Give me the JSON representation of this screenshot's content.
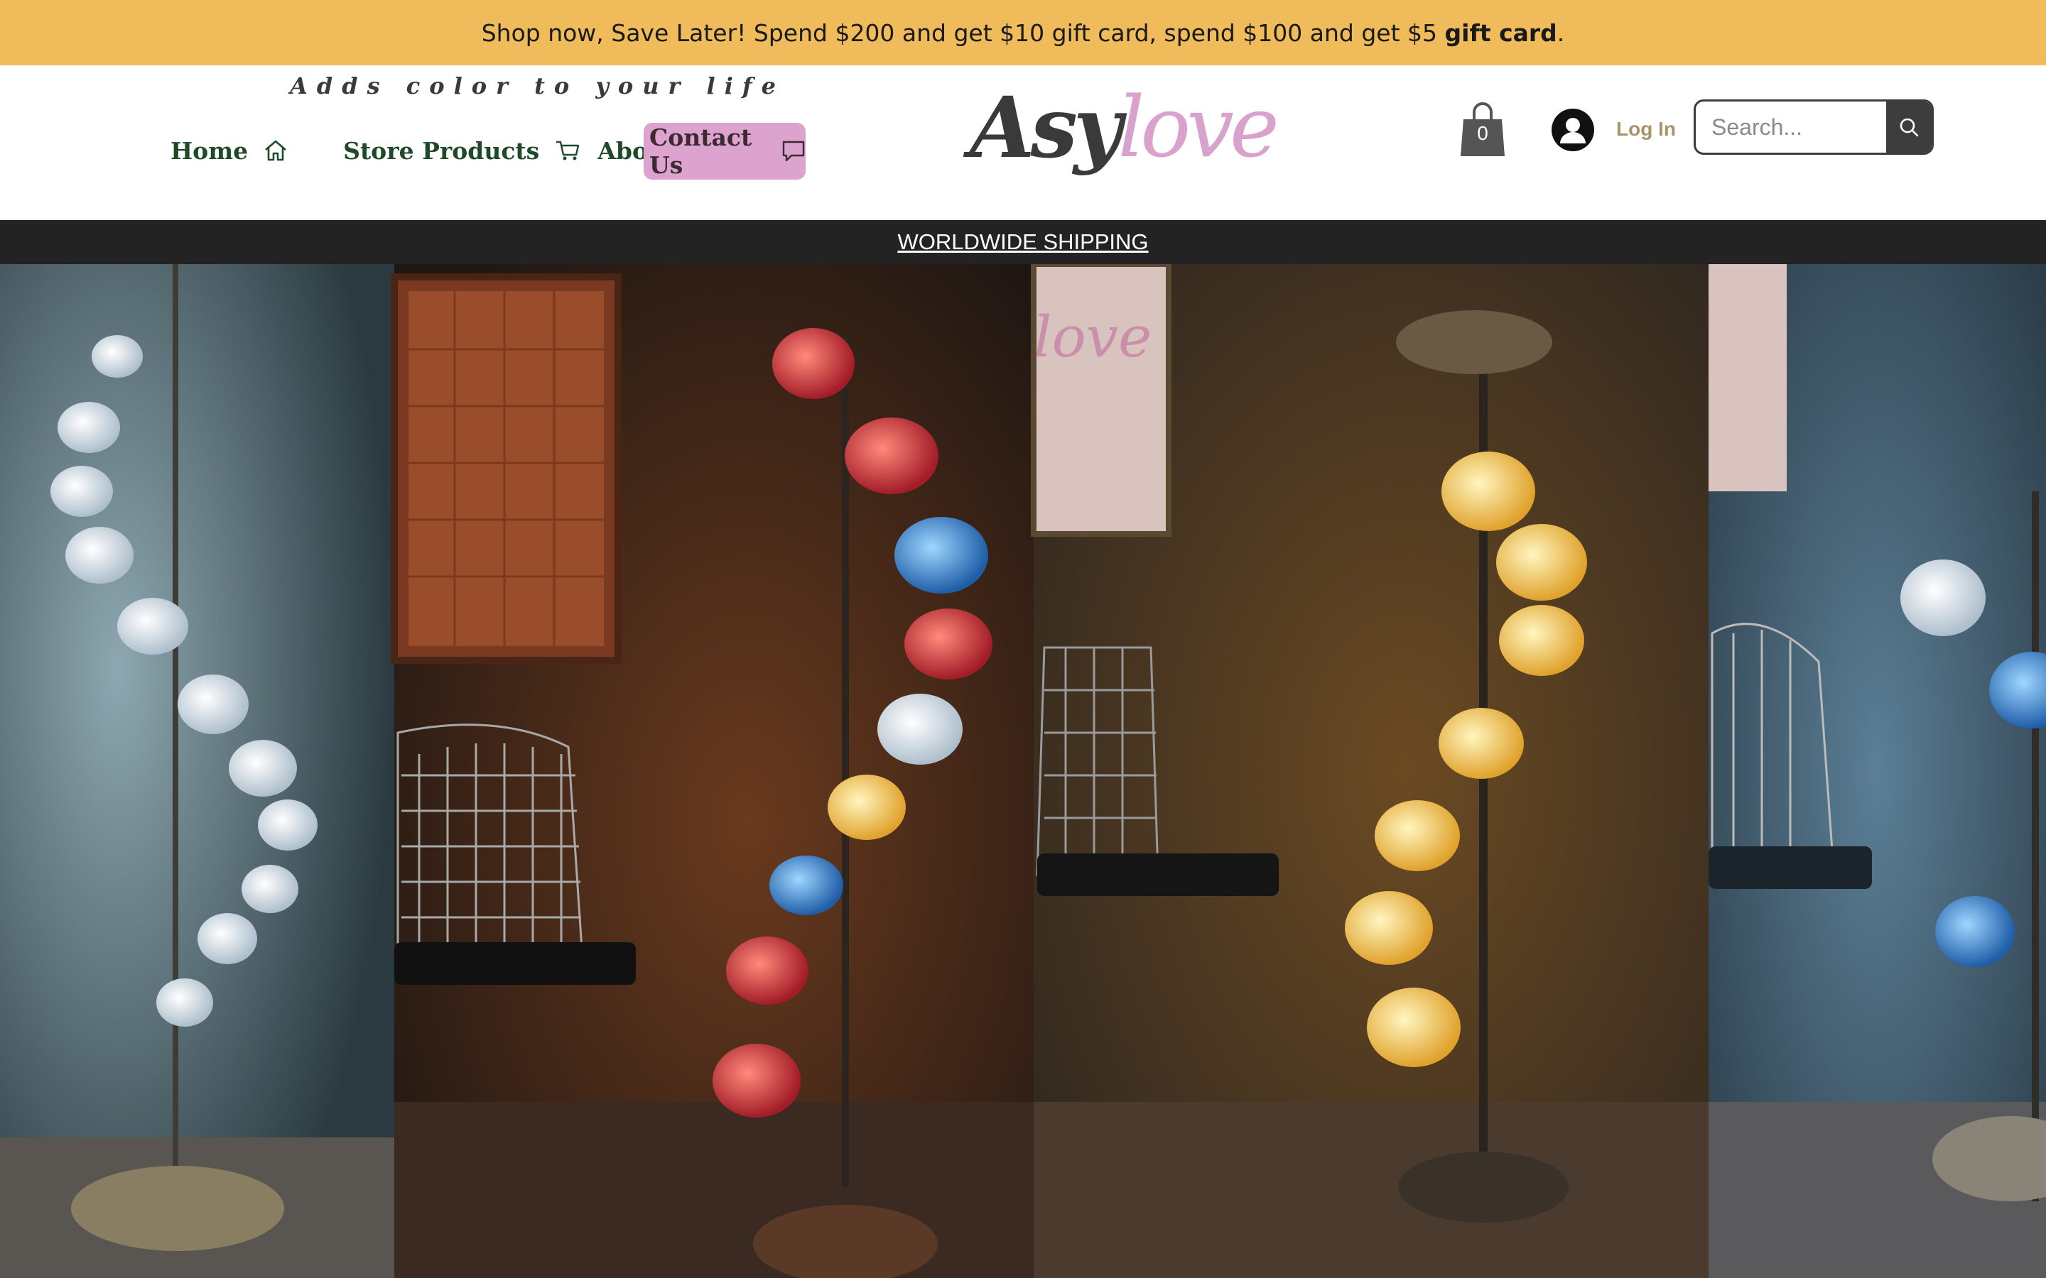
{
  "promo": {
    "text_lead": "Shop now, Save Later! Spend $200 and get $10 gift card, spend $100 and get $5 ",
    "text_bold": "gift card",
    "text_tail": "."
  },
  "header": {
    "tagline": "Adds color to your life",
    "nav": {
      "home": "Home",
      "store": "Store Products",
      "about": "About",
      "contact": "Contact Us"
    },
    "logo": {
      "part1": "Asy",
      "part2": "love"
    },
    "cart_count": "0",
    "login": "Log In",
    "search_placeholder": "Search..."
  },
  "shipping": {
    "label": "WORLDWIDE SHIPPING"
  },
  "colors": {
    "promo_bg": "#efbb5b",
    "nav_text": "#1f4a2a",
    "contact_bg": "#dca3cf",
    "logo_pink": "#d9a2cc",
    "login_text": "#a6946a",
    "shipping_bg": "#232323"
  },
  "icons": {
    "home": "home-icon",
    "cart_nav": "cart-icon",
    "contact": "chat-bubble-icon",
    "bag": "shopping-bag-icon",
    "user": "user-avatar-icon",
    "search": "search-icon"
  }
}
